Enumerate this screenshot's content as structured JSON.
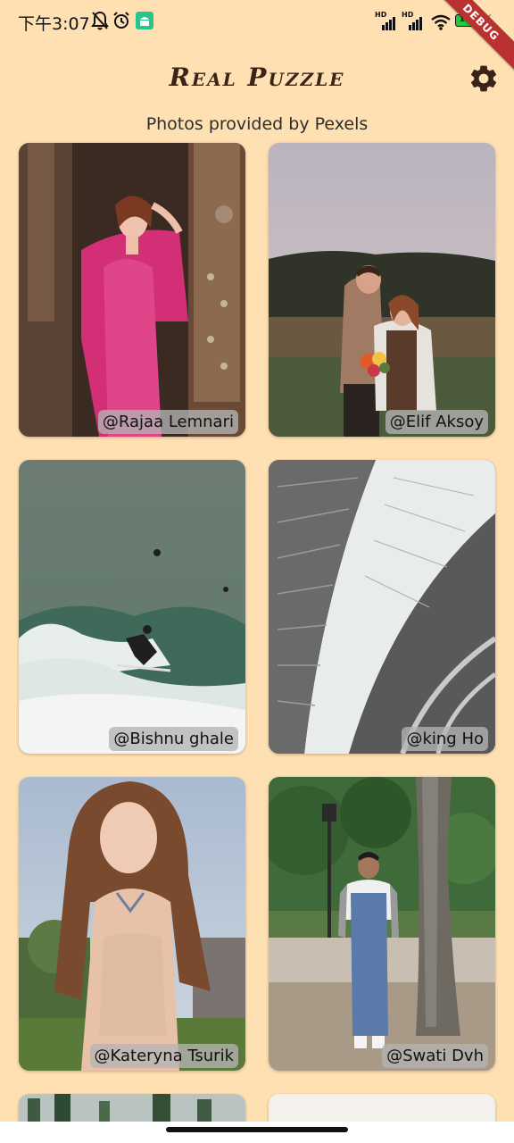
{
  "status_bar": {
    "time": "下午3:07",
    "battery": "100",
    "network_labels": [
      "HD",
      "HD"
    ],
    "icons": [
      "bell-off-icon",
      "alarm-icon",
      "android-icon",
      "wifi-icon",
      "bolt-icon"
    ]
  },
  "debug_banner": "DEBUG",
  "app_bar": {
    "title": "Real Puzzle",
    "settings_icon": "gear-icon"
  },
  "subtitle": "Photos provided by Pexels",
  "photos": [
    {
      "credit": "@Rajaa Lemnari"
    },
    {
      "credit": "@Elif Aksoy"
    },
    {
      "credit": "@Bishnu ghale"
    },
    {
      "credit": "@king Ho"
    },
    {
      "credit": "@Kateryna Tsurik"
    },
    {
      "credit": "@Swati Dvh"
    }
  ],
  "colors": {
    "background": "#FFE0B2",
    "title": "#3a2418",
    "debug": "#b9322f"
  }
}
